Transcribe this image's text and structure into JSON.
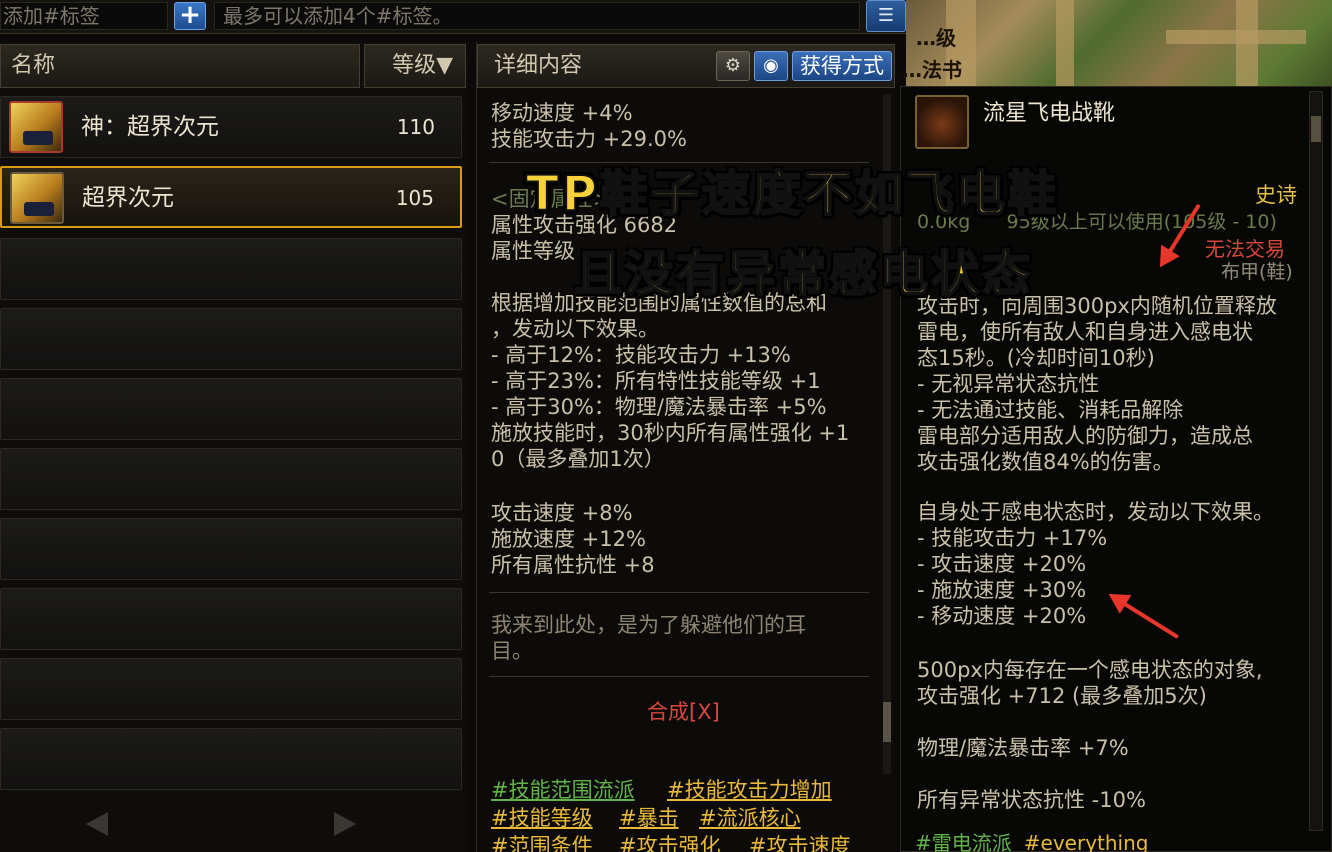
{
  "topbar": {
    "tag_input_placeholder": "添加#标签",
    "add_button": "+",
    "tag_hint": "最多可以添加4个#标签。",
    "list_button": "☰"
  },
  "scenery": {
    "text1": "…级",
    "text2": "…法书"
  },
  "left_panel": {
    "header_name": "名称",
    "header_level": "等级▼",
    "items": [
      {
        "name": "神：超界次元",
        "level": "110"
      },
      {
        "name": "超界次元",
        "level": "105"
      }
    ]
  },
  "detail_panel": {
    "title": "详细内容",
    "obtain_button": "获得方式",
    "lines_top": [
      "移动速度 +4%",
      "技能攻击力 +29.0%"
    ],
    "fixed_label": "<固定属性>",
    "attr_lines": [
      "属性攻击强化 6682",
      "属性等级"
    ],
    "effect_lines": [
      "根据增加技能范围的属性数值的总和",
      "，发动以下效果。",
      "- 高于12%：技能攻击力 +13%",
      "- 高于23%：所有特性技能等级 +1",
      "- 高于30%：物理/魔法暴击率 +5%",
      "施放技能时，30秒内所有属性强化 +1",
      "0（最多叠加1次）"
    ],
    "speed_lines": [
      "攻击速度 +8%",
      "施放速度 +12%",
      "所有属性抗性 +8"
    ],
    "quote_lines": [
      "我来到此处，是为了躲避他们的耳",
      "目。"
    ],
    "synth": "合成[X]",
    "tags": [
      "#技能范围流派",
      "#技能攻击力增加",
      "#技能等级",
      "#暴击",
      "#流派核心",
      "#范围条件",
      "#攻击强化",
      "#攻击速度"
    ]
  },
  "tooltip": {
    "item_name": "流星飞电战靴",
    "grade": "史诗",
    "requirement": "0.0kg      95级以上可以使用(105级 - 10)",
    "trade": "无法交易",
    "part": "布甲(鞋)",
    "effect_lines": [
      "攻击时，向周围300px内随机位置释放",
      "雷电，使所有敌人和自身进入感电状",
      "态15秒。(冷却时间10秒)",
      "- 无视异常状态抗性",
      "- 无法通过技能、消耗品解除",
      "雷电部分适用敌人的防御力，造成总",
      "攻击强化数值84%的伤害。"
    ],
    "self_lines": [
      "自身处于感电状态时，发动以下效果。",
      "- 技能攻击力 +17%",
      "- 攻击速度 +20%",
      "- 施放速度 +30%",
      "- 移动速度 +20%"
    ],
    "stack_lines": [
      "500px内每存在一个感电状态的对象,",
      "攻击强化 +712 (最多叠加5次)"
    ],
    "crit_line": "物理/魔法暴击率 +7%",
    "resist_line": "所有异常状态抗性 -10%",
    "footer_tags": [
      "#雷电流派",
      "#everything"
    ]
  },
  "captions": {
    "line1": "TP鞋子速度不如飞电鞋",
    "line2": "且没有异常感电状态"
  },
  "colors": {
    "caption": "#f8d23a",
    "arrow": "#e8362a",
    "tag_gold": "#e8b93a",
    "tag_green": "#63b34b",
    "selected_border": "#d99a16"
  }
}
